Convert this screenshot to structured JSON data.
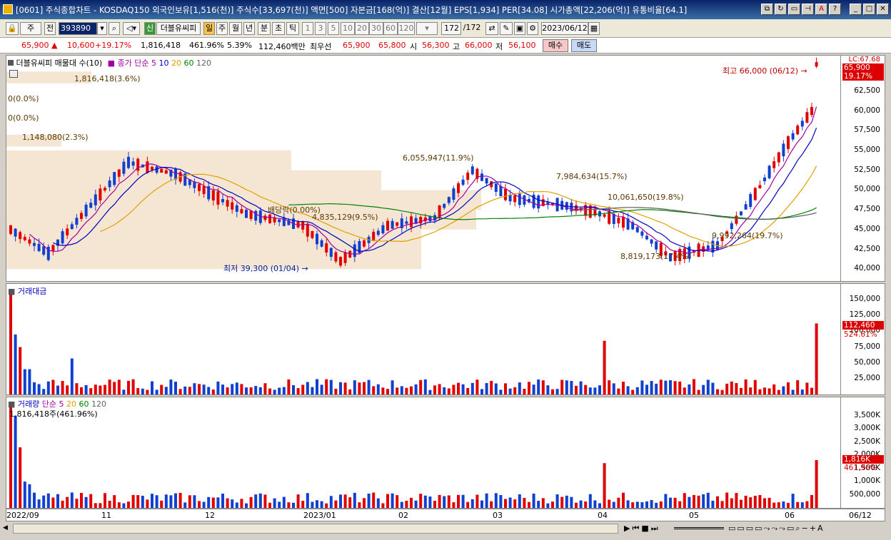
{
  "window": {
    "title": "[0601] 주식종합차트 - KOSDAQ150 외국인보유[1,516(천)] 주식수[33,697(천)] 액면[500] 자본금[168(억)] 결산[12월] EPS[1,934] PER[34.08] 시가총액[22,206(억)] 유통비율[64.1]"
  },
  "toolbar": {
    "market": "주",
    "whole": "전",
    "code": "393890",
    "stock_badge": "신",
    "stock_name": "더블유씨피",
    "periods": [
      "일",
      "주",
      "월",
      "년",
      "분",
      "초",
      "틱"
    ],
    "intervals": [
      "1",
      "3",
      "5",
      "10",
      "20",
      "30",
      "60",
      "120"
    ],
    "count": "172",
    "total": "/172",
    "date": "2023/06/12"
  },
  "quote": {
    "price": "65,900 ▲",
    "change": "10,600",
    "rate": "+19.17%",
    "volume": "1,816,418",
    "vol_ratio": "461.96%",
    "turnover": "5.39%",
    "amount": "112,460백만",
    "best_label": "최우선",
    "ask": "65,900",
    "bid": "65,800",
    "open_label": "시",
    "open": "56,300",
    "high_label": "고",
    "high": "66,000",
    "low_label": "저",
    "low": "56,100",
    "buy": "매수",
    "sell": "매도"
  },
  "price_panel": {
    "legend_name": "더블유씨피 매물대 수(10)",
    "ma_label": "종가 단순",
    "ma_periods": [
      "5",
      "10",
      "20",
      "60",
      "120"
    ],
    "ma_colors": [
      "#a000a0",
      "#0000c0",
      "#e0a000",
      "#008000",
      "#606060"
    ],
    "lc_label": "LC:67.68",
    "last_price": "65,900",
    "last_rate": "19.17%",
    "high_note": "최고 66,000 (06/12) →",
    "low_note": "최저 39,300 (01/04) →",
    "dividend": "배당락(0.00%)",
    "y_ticks": [
      "62,500",
      "60,000",
      "57,500",
      "55,000",
      "52,500",
      "50,000",
      "47,500",
      "45,000",
      "42,500",
      "40,000"
    ],
    "volume_profile": [
      {
        "label": "1,816,418(3.6%)",
        "price_from": 63500,
        "price_to": 65000,
        "width": 0.17
      },
      {
        "label": "0(0.0%)",
        "price_from": 61000,
        "price_to": 62000,
        "width": 0.0
      },
      {
        "label": "0(0.0%)",
        "price_from": 58500,
        "price_to": 59500,
        "width": 0.0
      },
      {
        "label": "1,148,080(2.3%)",
        "price_from": 55500,
        "price_to": 57000,
        "width": 0.11
      },
      {
        "label": "6,055,947(11.9%)",
        "price_from": 52500,
        "price_to": 55000,
        "width": 0.57
      },
      {
        "label": "7,984,634(15.7%)",
        "price_from": 50000,
        "price_to": 52500,
        "width": 0.75
      },
      {
        "label": "10,061,650(19.8%)",
        "price_from": 47500,
        "price_to": 50000,
        "width": 0.95
      },
      {
        "label": "9,992,264(19.7%)",
        "price_from": 45000,
        "price_to": 47500,
        "width": 0.94
      },
      {
        "label": "4,835,129(9.5%)",
        "price_from": 45000,
        "price_to": 47500,
        "width": 0.45
      },
      {
        "label": "8,819,173(17.4%)",
        "price_from": 40000,
        "price_to": 45000,
        "width": 0.83
      }
    ]
  },
  "amount_panel": {
    "legend": "거래대금",
    "y_ticks": [
      "150,000",
      "125,000",
      "100,000",
      "75,000",
      "50,000",
      "25,000"
    ],
    "last": "112,460",
    "last_rate": "524.61%"
  },
  "volume_panel": {
    "legend": "거래량",
    "ma_label": "단순",
    "ma_periods": [
      "5",
      "20",
      "60",
      "120"
    ],
    "value_note": "1,816,418주(461.96%)",
    "y_ticks": [
      "3,500K",
      "3,000K",
      "2,500K",
      "2,000K",
      "1,500K",
      "1,000K",
      "500,000"
    ],
    "last": "1,816K",
    "last_rate": "461.96%"
  },
  "x_axis": {
    "ticks": [
      "2022/09",
      "11",
      "12",
      "2023/01",
      "02",
      "03",
      "04",
      "05",
      "06"
    ],
    "right_label": "06/12"
  },
  "colors": {
    "up": "#e00000",
    "down": "#1040d0",
    "band": "#f5e6d3"
  }
}
